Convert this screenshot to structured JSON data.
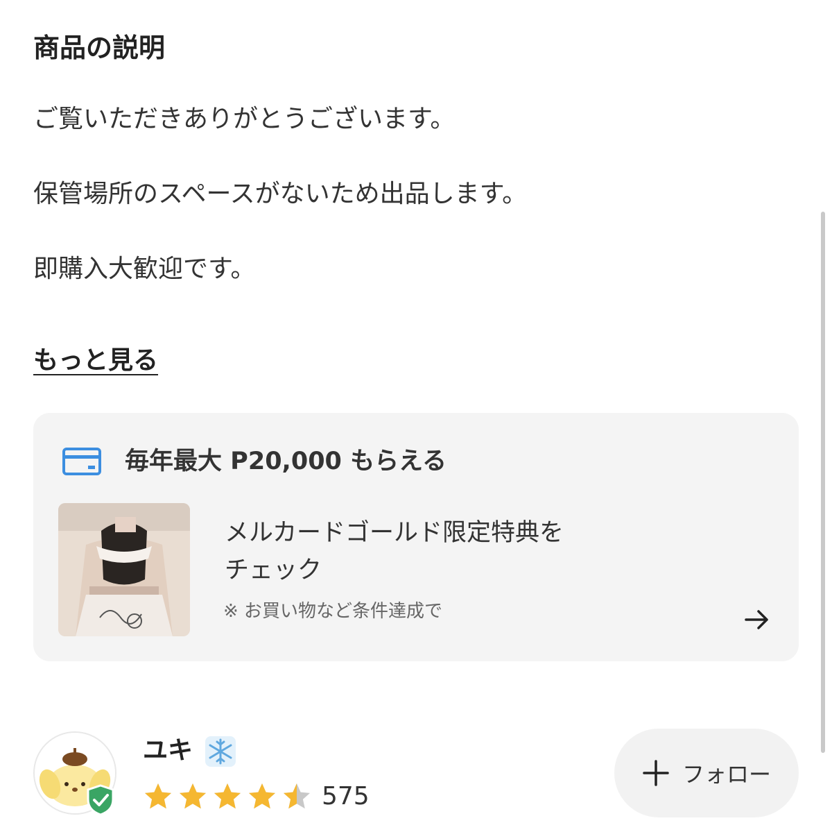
{
  "description": {
    "title": "商品の説明",
    "lines": [
      "ご覧いただきありがとうございます。",
      "保管場所のスペースがないため出品します。",
      "即購入大歓迎です。"
    ],
    "more_label": "もっと見る"
  },
  "promo": {
    "icon": "credit-card-icon",
    "headline": "毎年最大 P20,000 もらえる",
    "text_line1": "メルカードゴールド限定特典を",
    "text_line2": "チェック",
    "note": "※ お買い物など条件達成で",
    "arrow_icon": "arrow-right-icon",
    "accent_color": "#3c8ee0"
  },
  "seller": {
    "name": "ユキ",
    "name_emoji_icon": "snowflake-icon",
    "avatar_icon": "pompompurin-avatar",
    "verified_icon": "verified-shield-icon",
    "rating": 4.5,
    "rating_max": 5,
    "review_count": "575",
    "star_color": "#f5b731",
    "follow_label": "フォロー"
  }
}
